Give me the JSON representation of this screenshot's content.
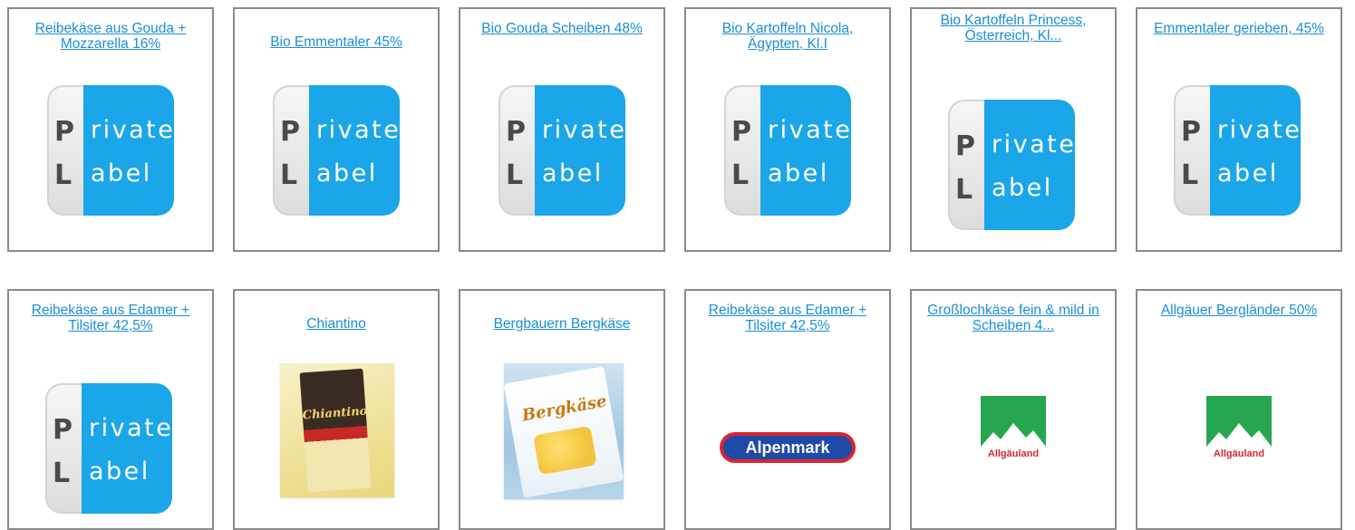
{
  "products": [
    {
      "title": "Reibekäse aus Gouda + Mozzarella 16%",
      "image": "private-label"
    },
    {
      "title": "Bio Emmentaler 45%",
      "image": "private-label"
    },
    {
      "title": "Bio Gouda Scheiben 48%",
      "image": "private-label"
    },
    {
      "title": "Bio Kartoffeln Nicola, Ägypten, Kl.I",
      "image": "private-label"
    },
    {
      "title": "Bio Kartoffeln Princess, Österreich, Kl...",
      "image": "private-label"
    },
    {
      "title": "Emmentaler gerieben, 45%",
      "image": "private-label"
    },
    {
      "title": "Reibekäse aus Edamer + Tilsiter 42,5%",
      "image": "private-label"
    },
    {
      "title": "Chiantino",
      "image": "chiantino-package",
      "package_text": "Chiantino"
    },
    {
      "title": "Bergbauern Bergkäse",
      "image": "bergkase-package",
      "package_text": "Bergkäse"
    },
    {
      "title": "Reibekäse aus Edamer + Tilsiter 42,5%",
      "image": "alpenmark-logo",
      "logo_text": "Alpenmark"
    },
    {
      "title": "Großlochkäse fein & mild in Scheiben 4...",
      "image": "allgauland-logo",
      "logo_text": "Allgäuland"
    },
    {
      "title": "Allgäuer Bergländer 50%",
      "image": "allgauland-logo",
      "logo_text": "Allgäuland"
    }
  ],
  "private_label": {
    "line1_cap": "P",
    "line1_rest": "rivate",
    "line2_cap": "L",
    "line2_rest": "abel"
  },
  "colors": {
    "link": "#1a8ed8",
    "card_border": "#8a8a8a",
    "private_label_blue": "#1aa6e8",
    "allgau_green": "#27a651",
    "alpenmark_red": "#d8262f",
    "alpenmark_blue": "#1f4aa8"
  }
}
